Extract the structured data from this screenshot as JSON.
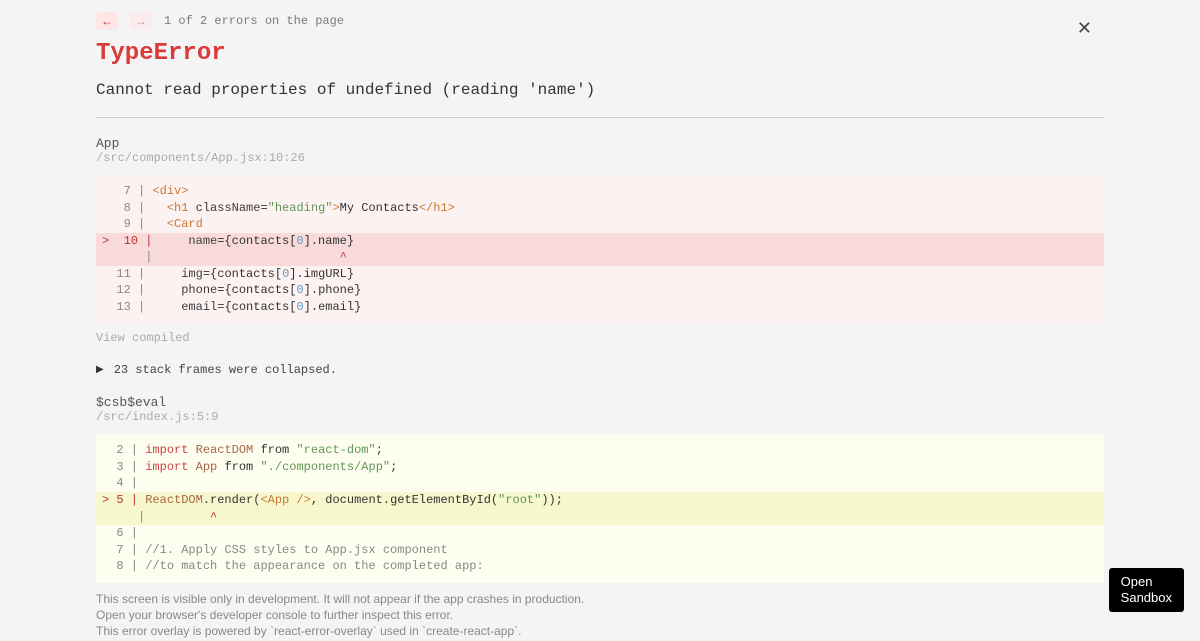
{
  "nav": {
    "count_text": "1 of 2 errors on the page"
  },
  "error": {
    "type": "TypeError",
    "message": "Cannot read properties of undefined (reading 'name')"
  },
  "frame1": {
    "title": "App",
    "path": "/src/components/App.jsx:10:26",
    "view_compiled": "View compiled"
  },
  "collapsed": {
    "text": "23 stack frames were collapsed."
  },
  "frame2": {
    "title": "$csb$eval",
    "path": "/src/index.js:5:9"
  },
  "footer": {
    "l1": "This screen is visible only in development. It will not appear if the app crashes in production.",
    "l2": "Open your browser's developer console to further inspect this error.",
    "l3": "This error overlay is powered by `react-error-overlay` used in `create-react-app`."
  },
  "sandbox_btn": "Open Sandbox",
  "code1": {
    "l1_gut": "   7 | ",
    "l2_gut": "   8 | ",
    "l3_gut": "   9 | ",
    "l4_gut": ">  10 | ",
    "l5_gut": "      | ",
    "l6_gut": "  11 | ",
    "l7_gut": "  12 | ",
    "l8_gut": "  13 | "
  },
  "code2": {
    "l1_gut": "  2 | ",
    "l2_gut": "  3 | ",
    "l3_gut": "  4 | ",
    "l4_gut": "> 5 | ",
    "l5_gut": "     | ",
    "l6_gut": "  6 | ",
    "l7_gut": "  7 | ",
    "l8_gut": "  8 | "
  }
}
